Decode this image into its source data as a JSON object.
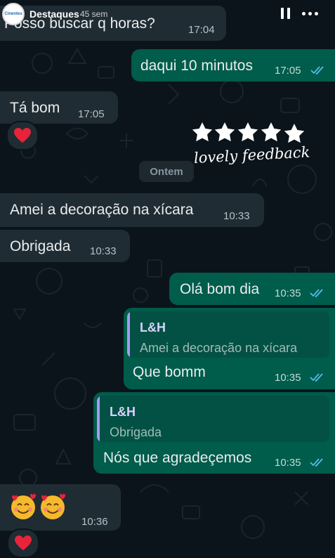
{
  "story": {
    "avatar_text": "Cinentes",
    "highlight_title": "Destaques",
    "age": "45 sem"
  },
  "sticker": {
    "text": "lovely feedback",
    "stars": 5
  },
  "date_separator": "Ontem",
  "messages": [
    {
      "text": "Posso buscar q horas?",
      "time": "17:04",
      "direction": "incoming"
    },
    {
      "text": "daqui 10 minutos",
      "time": "17:05",
      "direction": "outgoing",
      "status": "read"
    },
    {
      "text": "Tá bom",
      "time": "17:05",
      "direction": "incoming",
      "reaction": "heart"
    },
    {
      "text": "Amei a decoração na xícara",
      "time": "10:33",
      "direction": "incoming"
    },
    {
      "text": "Obrigada",
      "time": "10:33",
      "direction": "incoming"
    },
    {
      "text": "Olá bom dia",
      "time": "10:35",
      "direction": "outgoing",
      "status": "read"
    },
    {
      "text": "Que bomm",
      "time": "10:35",
      "direction": "outgoing",
      "status": "read",
      "quote": {
        "author": "L&H",
        "text": "Amei a decoração na xícara"
      }
    },
    {
      "text": "Nós que agradeçemos",
      "time": "10:35",
      "direction": "outgoing",
      "status": "read",
      "quote": {
        "author": "L&H",
        "text": "Obrigada"
      }
    },
    {
      "emoji": "smiling-face-with-hearts",
      "count": 2,
      "time": "10:36",
      "direction": "incoming",
      "reaction": "heart"
    }
  ],
  "colors": {
    "background": "#0b141a",
    "incoming_bubble": "#202c33",
    "outgoing_bubble": "#005c4b",
    "read_ticks": "#53bdeb",
    "reaction_heart": "#e8233a"
  }
}
